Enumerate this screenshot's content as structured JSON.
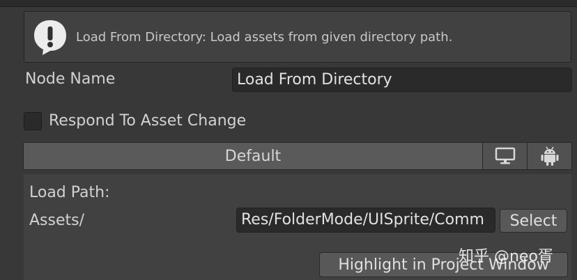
{
  "help": {
    "text": "Load From Directory: Load assets from given directory path."
  },
  "node_name": {
    "label": "Node Name",
    "value": "Load From Directory"
  },
  "respond_toggle": {
    "label": "Respond To Asset Change",
    "checked": false
  },
  "platform_tabs": {
    "default_label": "Default",
    "icons": [
      "monitor-icon",
      "android-icon"
    ]
  },
  "load_path": {
    "heading": "Load Path:",
    "prefix": "Assets/",
    "value": "Res/FolderMode/UISprite/Comm",
    "select_label": "Select",
    "highlight_label": "Highlight in Project Window"
  },
  "watermark": "知乎 @neo胥",
  "colors": {
    "background": "#383838",
    "panel": "#414141",
    "field": "#2a2a2a",
    "tab_selected": "#5a5a5a",
    "button": "#585858"
  }
}
